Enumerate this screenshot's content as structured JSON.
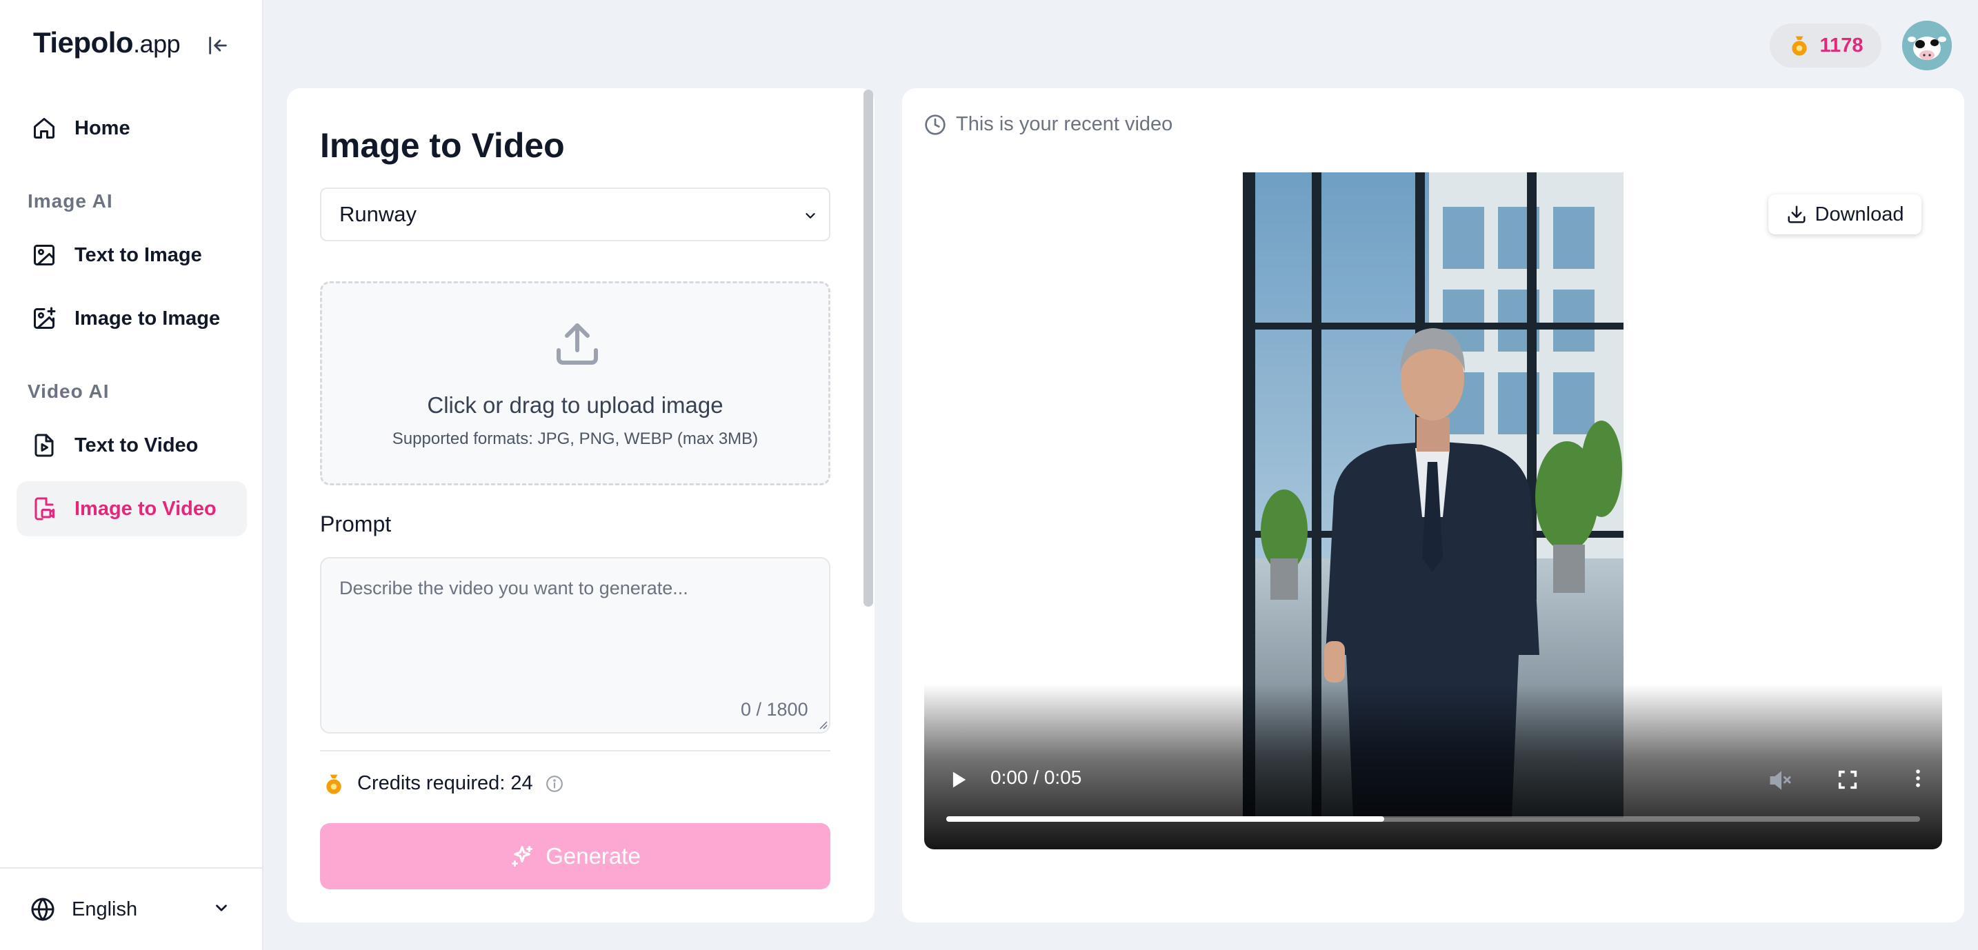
{
  "brand": {
    "name": "Tiepolo",
    "suffix": ".app"
  },
  "sidebar": {
    "home": "Home",
    "section_image": "Image AI",
    "text_to_image": "Text to Image",
    "image_to_image": "Image to Image",
    "section_video": "Video AI",
    "text_to_video": "Text to Video",
    "image_to_video": "Image to Video",
    "active_item": "image_to_video",
    "language": "English"
  },
  "header": {
    "credits": "1178"
  },
  "form": {
    "title": "Image to Video",
    "model": "Runway",
    "upload_title": "Click or drag to upload image",
    "upload_sub": "Supported formats: JPG, PNG, WEBP (max 3MB)",
    "prompt_label": "Prompt",
    "prompt_placeholder": "Describe the video you want to generate...",
    "char_count": "0 / 1800",
    "credits_required": "Credits required: 24",
    "generate_label": "Generate"
  },
  "result": {
    "note": "This is your recent video",
    "download_label": "Download",
    "video": {
      "current_time": "0:00",
      "separator": "/",
      "duration": "0:05",
      "progress": 0.45
    }
  },
  "colors": {
    "accent": "#e3277b",
    "generate_bg": "#fca8d3",
    "coin": "#f59e0b"
  },
  "icons": [
    "home-icon",
    "collapse-sidebar-icon",
    "image-icon",
    "image-plus-icon",
    "file-video-icon",
    "video-image-icon",
    "globe-icon",
    "chevron-down-icon",
    "coin-icon",
    "upload-icon",
    "info-icon",
    "sparkles-icon",
    "clock-icon",
    "download-icon",
    "play-icon",
    "mute-icon",
    "fullscreen-icon",
    "more-vertical-icon"
  ]
}
